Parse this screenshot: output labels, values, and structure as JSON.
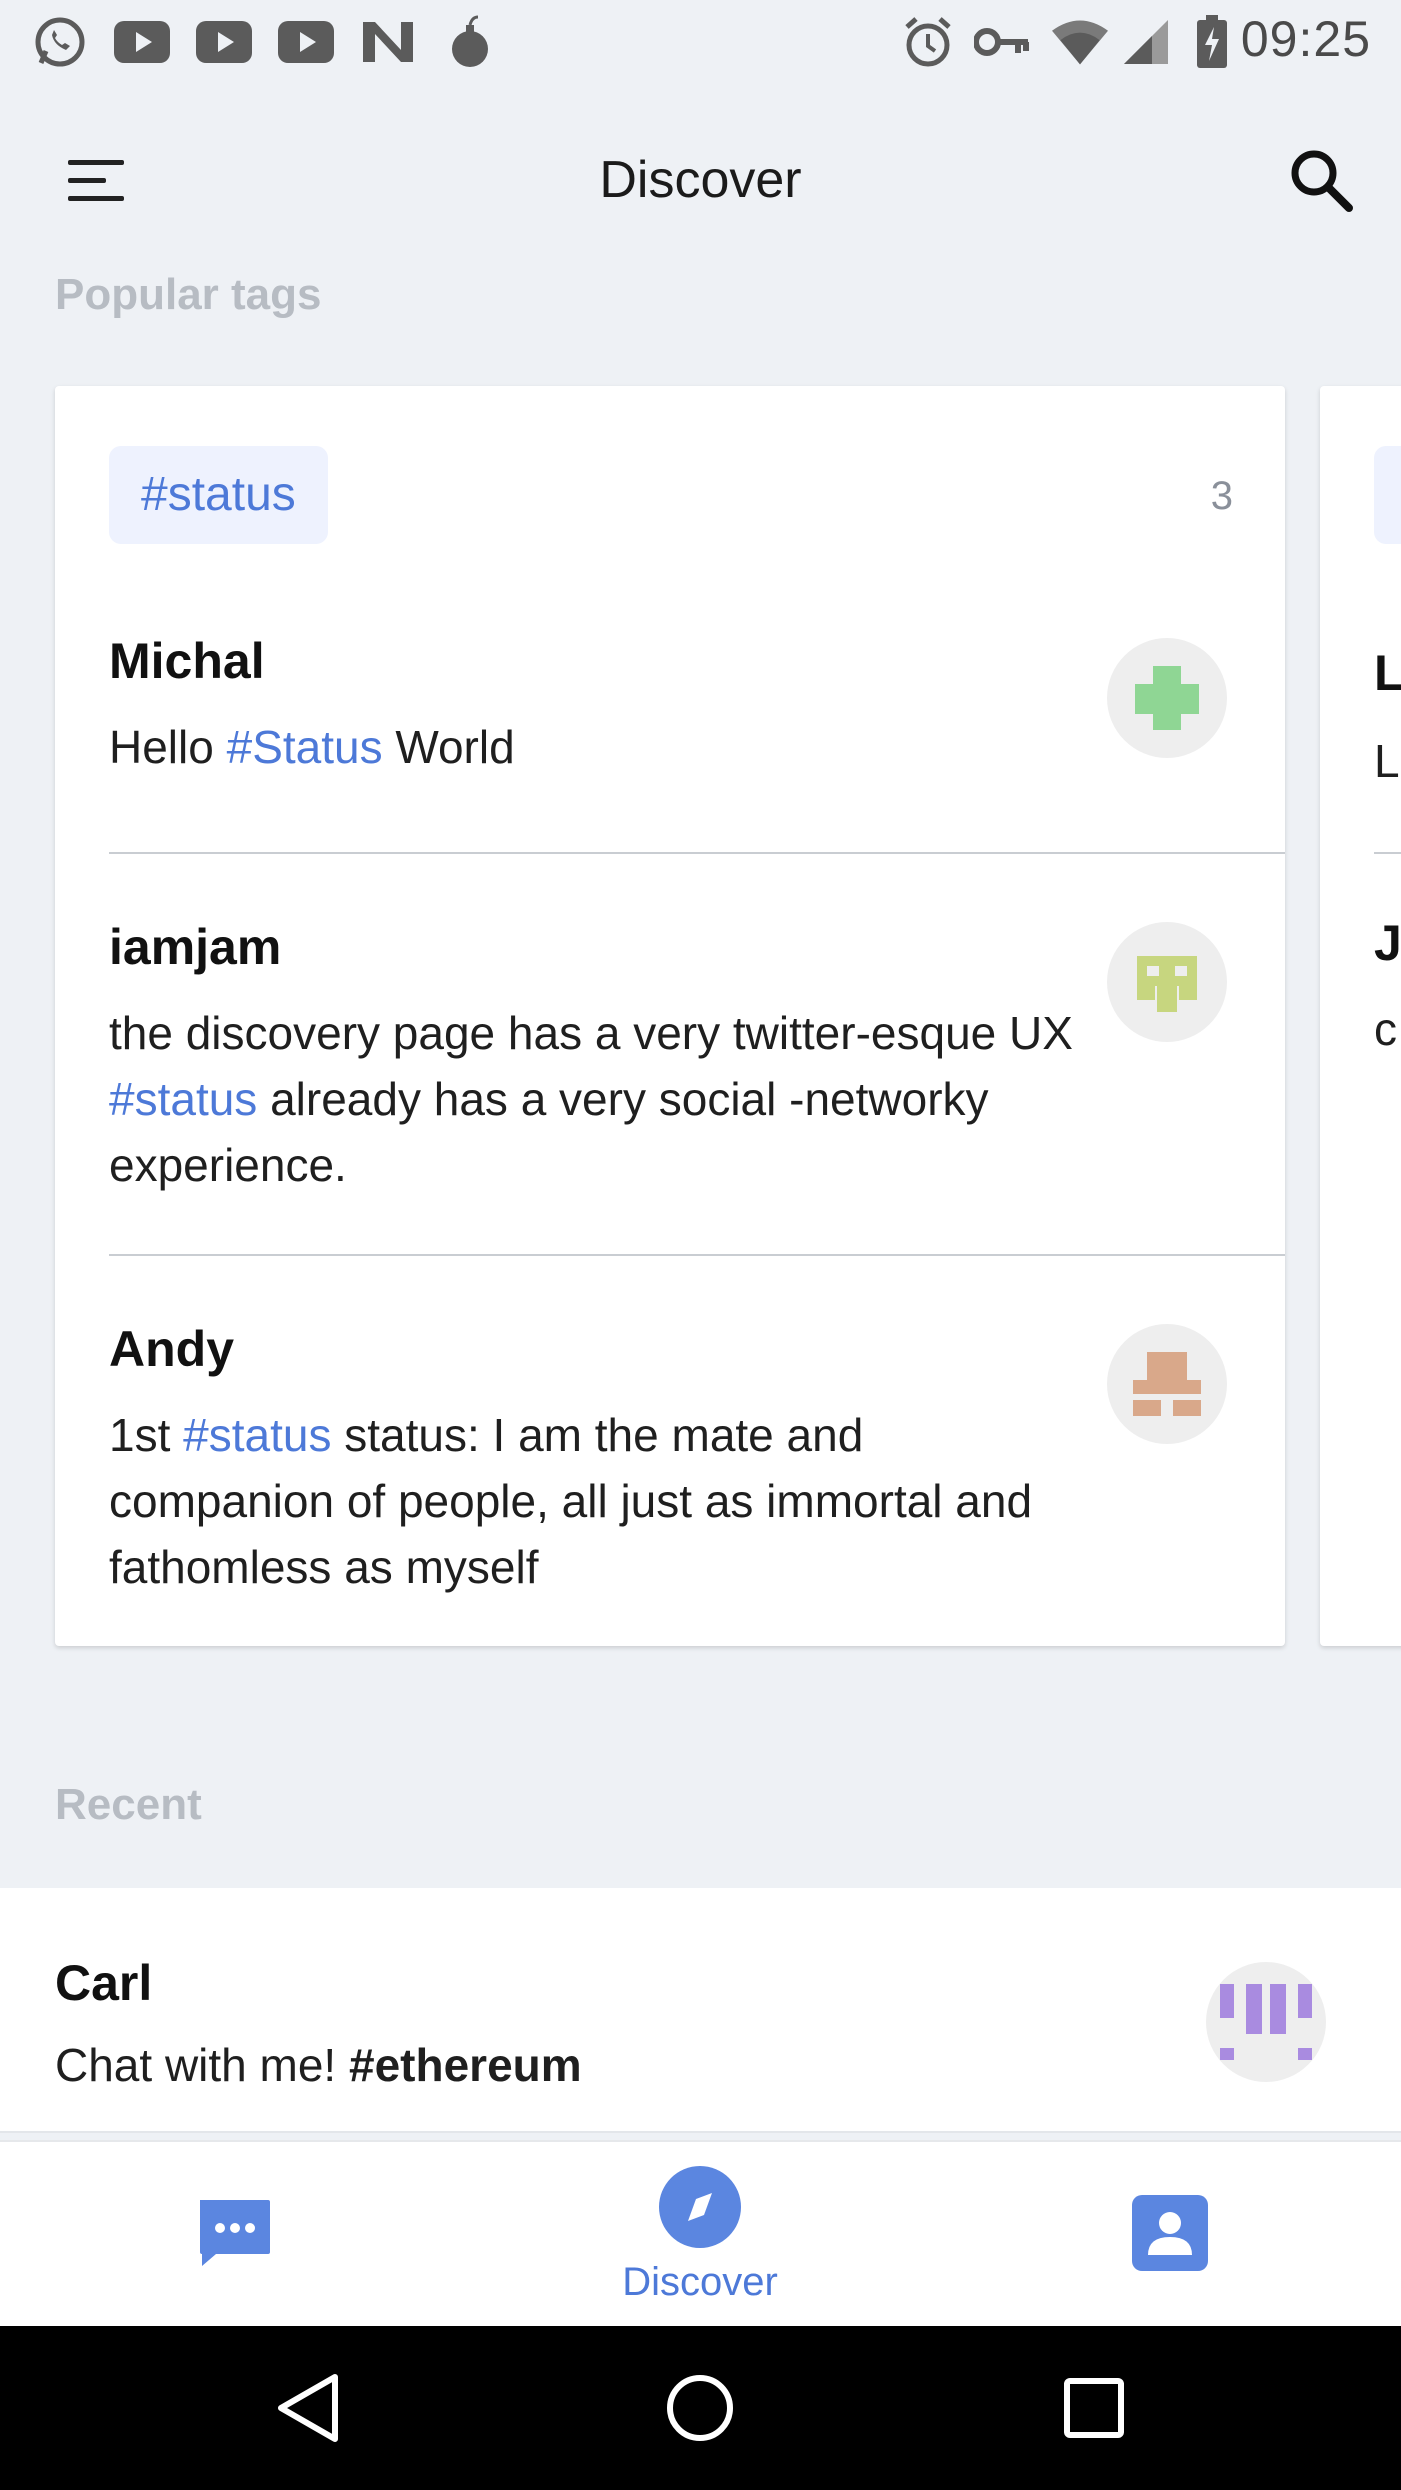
{
  "status_bar": {
    "time": "09:25",
    "left_icons": [
      "whatsapp-icon",
      "youtube-icon",
      "youtube-icon",
      "youtube-icon",
      "n-app-icon",
      "bomb-icon"
    ],
    "right_icons": [
      "alarm-icon",
      "key-icon",
      "wifi-icon",
      "signal-icon",
      "battery-charging-icon"
    ]
  },
  "toolbar": {
    "title": "Discover",
    "menu_icon": "hamburger-menu-icon",
    "search_icon": "search-icon"
  },
  "popular_tags": {
    "section_label": "Popular tags",
    "card": {
      "tag": "#status",
      "count": "3",
      "posts": [
        {
          "author": "Michal",
          "text_before": "Hello ",
          "hashtag": "#Status",
          "text_after": " World",
          "avatar_color": "#8fd694"
        },
        {
          "author": "iamjam",
          "text_before": "the discovery page has a very twitter-esque UX ",
          "hashtag": "#status",
          "text_after": " already has a very social -networky experience.",
          "avatar_color": "#c7d67f"
        },
        {
          "author": "Andy",
          "text_before": "1st ",
          "hashtag": "#status",
          "text_after": " status: I am the mate and companion of people, all just as immortal and fathomless as myself",
          "avatar_color": "#d9a88a"
        }
      ]
    },
    "next_card_peek": {
      "first_author_initial": "L",
      "first_text_initial": "L",
      "second_author_initial": "J",
      "second_text_initial": "c"
    }
  },
  "recent": {
    "section_label": "Recent",
    "items": [
      {
        "author": "Carl",
        "text_before": "Chat with me! ",
        "hashtag": "#ethereum",
        "avatar_color": "#a98be0"
      }
    ]
  },
  "bottom_nav": {
    "items": [
      {
        "icon": "chat-bubble-icon",
        "label": ""
      },
      {
        "icon": "compass-icon",
        "label": "Discover"
      },
      {
        "icon": "profile-icon",
        "label": ""
      }
    ],
    "accent": "#4d79d8"
  },
  "system_nav": {
    "buttons": [
      "back-icon",
      "home-icon",
      "recents-icon"
    ]
  }
}
